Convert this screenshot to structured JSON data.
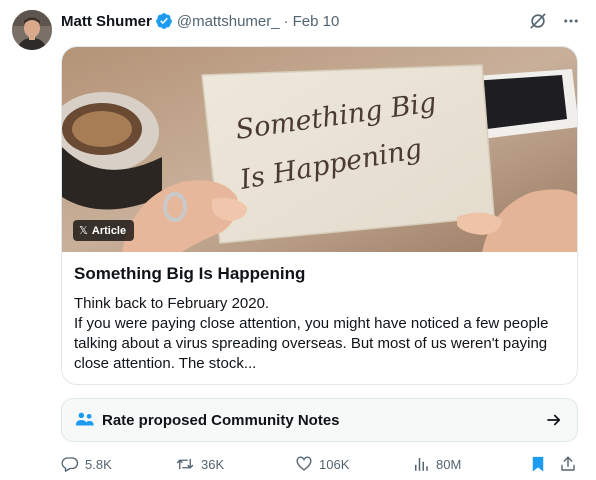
{
  "tweet": {
    "author_name": "Matt Shumer",
    "handle": "@mattshumer_",
    "separator": "·",
    "date": "Feb 10"
  },
  "article": {
    "badge_label": "Article",
    "badge_icon": "x-logo-icon",
    "image_text_line1": "Something Big",
    "image_text_line2": "Is Happening",
    "title": "Something Big Is Happening",
    "body_line1": "Think back to February 2020.",
    "body_line2": "If you were paying close attention, you might have noticed a few people talking about a virus spreading overseas. But most of us weren't paying close attention. The stock..."
  },
  "community_notes": {
    "label": "Rate proposed Community Notes",
    "icon": "people-icon",
    "accent_color": "#1d9bf0"
  },
  "actions": {
    "replies": "5.8K",
    "reposts": "36K",
    "likes": "106K",
    "views": "80M",
    "bookmark_color": "#1d9bf0"
  },
  "colors": {
    "text": "#0f1419",
    "secondary": "#536471",
    "verified": "#1d9bf0",
    "border": "#e1e8ed"
  }
}
